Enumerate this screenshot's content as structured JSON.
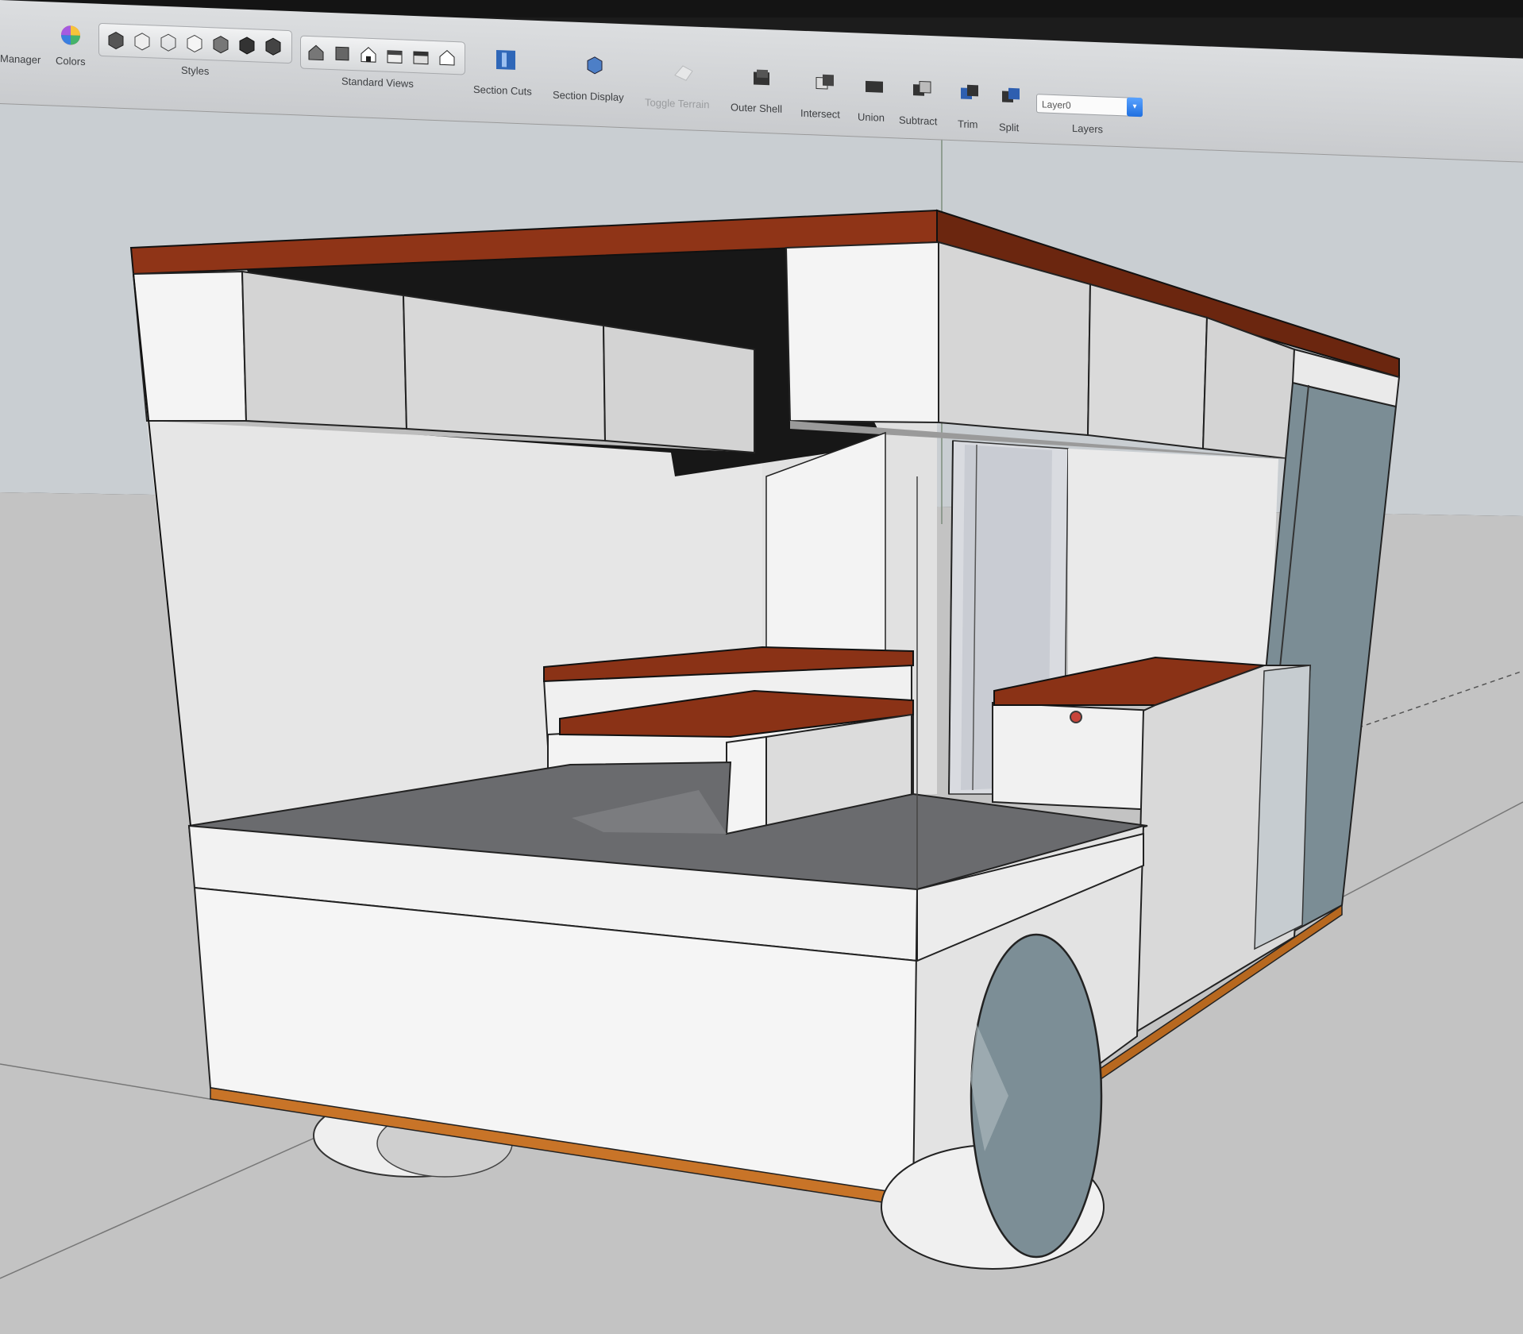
{
  "toolbar": {
    "groups": {
      "manager": "Manager",
      "colors": "Colors",
      "styles": "Styles",
      "standard_views": "Standard Views",
      "section_cuts": "Section Cuts",
      "section_display": "Section Display",
      "toggle_terrain": "Toggle Terrain",
      "outer_shell": "Outer Shell",
      "intersect": "Intersect",
      "union": "Union",
      "subtract": "Subtract",
      "trim": "Trim",
      "split": "Split",
      "layers": "Layers"
    },
    "layer_value": "Layer0",
    "icons": {
      "colors": "color-wheel-icon",
      "styles": "style-cube-icon",
      "views": "house-view-icon",
      "section": "section-plane-icon",
      "solid": "solid-tool-icon"
    }
  },
  "viewport": {
    "colors": {
      "sky": "#c9ced2",
      "ground": "#c4c4c4",
      "wood": "#8f3417",
      "white_face": "#f2f2f2",
      "shade_face": "#d8d8d8",
      "floor": "#6b6c6e",
      "glass": "#7c8e96"
    }
  }
}
